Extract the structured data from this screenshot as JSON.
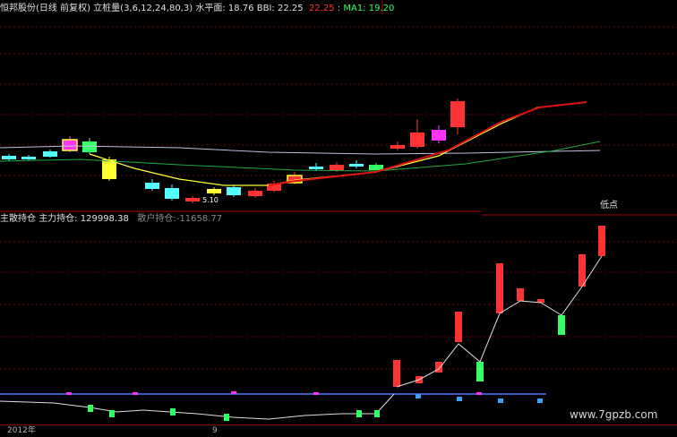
{
  "top_header": {
    "stock_name": "恒邦股份",
    "period": "(日线 前复权)",
    "indicator_name": "立桩量",
    "indicator_params": "(3,6,12,24,80,3)",
    "level_label": "水平面:",
    "level_value": "18.76",
    "bbi_label": "BBI:",
    "bbi_value": "22.25",
    "red_value": "22.25",
    "ma1_label": "MA1:",
    "ma1_value": "19.20"
  },
  "mid_header": {
    "title": "主散持仓",
    "main_label": "主力持仓:",
    "main_value": "129998.38",
    "retail_label": "散户持仓:",
    "retail_value": "-11658.77"
  },
  "price_marker": "5.10",
  "low_label": "低点",
  "watermark": "www.7gpzb.com",
  "date_axis": {
    "year_label": "2012年",
    "month_label": "9"
  },
  "colors": {
    "background": "#000000",
    "up_candle": "#ff3333",
    "down_candle": "#54ffff",
    "magenta": "#ff33ff",
    "yellow": "#ffff33",
    "green_candle": "#33ff66",
    "bbi_line": "#dd1111",
    "ma_line": "#c0c0e0",
    "level_line": "#22aa44",
    "grid": "#7a0000"
  }
}
